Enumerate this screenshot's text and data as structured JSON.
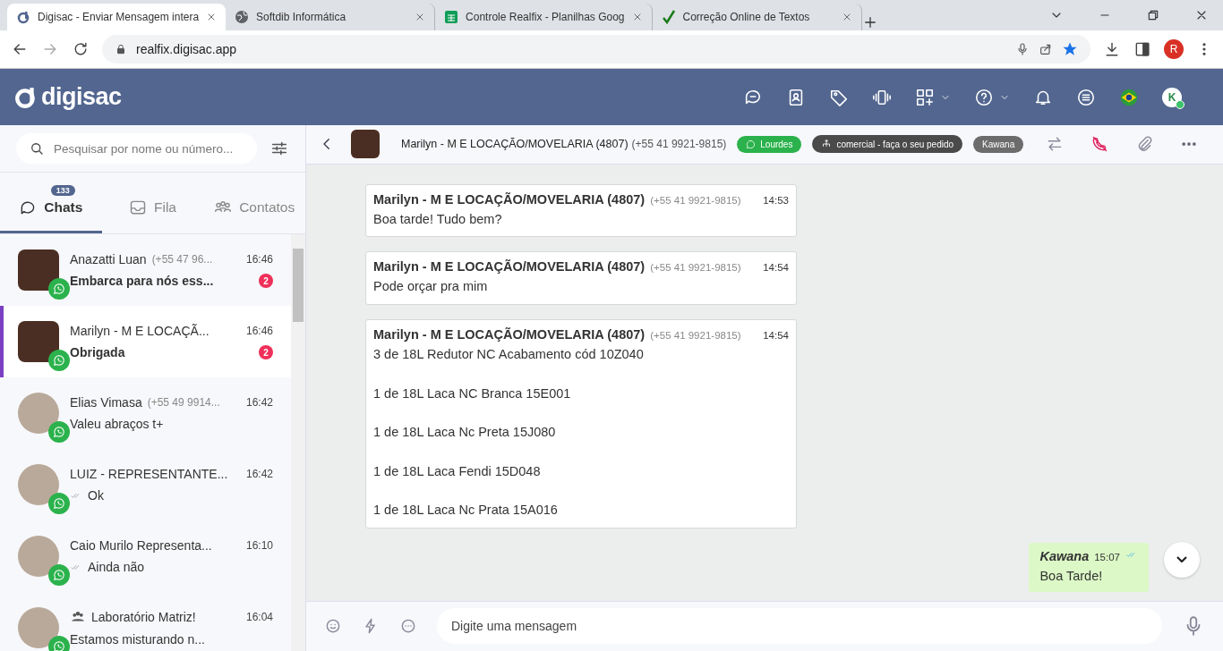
{
  "browser": {
    "tabs": [
      {
        "title": "Digisac - Enviar Mensagem intera",
        "kind": "digisac",
        "selected": true
      },
      {
        "title": "Softdib Informática",
        "kind": "globe",
        "selected": false
      },
      {
        "title": "Controle Realfix - Planilhas Goog",
        "kind": "sheets",
        "selected": false
      },
      {
        "title": "Correção Online de Textos",
        "kind": "check",
        "selected": false
      }
    ],
    "url": "realfix.digisac.app",
    "profile": "R"
  },
  "header": {
    "logo": "digisac",
    "user": "K"
  },
  "sidebar": {
    "search": {
      "placeholder": "Pesquisar por nome ou número..."
    },
    "tabs": [
      {
        "label": "Chats",
        "kind": "chat",
        "badge": "133",
        "selected": true
      },
      {
        "label": "Fila",
        "kind": "inbox",
        "selected": false
      },
      {
        "label": "Contatos",
        "kind": "people",
        "selected": false
      }
    ],
    "chats": [
      {
        "name": "Anazatti Luan",
        "phone": "(+55 47 96...",
        "time": "16:46",
        "preview": "Embarca para nós ess...",
        "unread": "2",
        "kind": "logo",
        "selected": false
      },
      {
        "name": "Marilyn - M E LOCAÇÃ...",
        "time": "16:46",
        "preview": "Obrigada",
        "unread": "2",
        "kind": "logo",
        "selected": true
      },
      {
        "name": "Elias Vimasa",
        "phone": "(+55 49 9914...",
        "time": "16:42",
        "preview": "Valeu abraços t+",
        "kind": "photo",
        "selected": false
      },
      {
        "name": "LUIZ - REPRESENTANTE...",
        "time": "16:42",
        "preview": "Ok",
        "ticks": true,
        "kind": "photo",
        "selected": false
      },
      {
        "name": "Caio Murilo Representa...",
        "time": "16:10",
        "preview": "Ainda não",
        "ticks": true,
        "kind": "photo",
        "selected": false
      },
      {
        "name": "Laboratório Matriz!",
        "group": true,
        "time": "16:04",
        "preview": "Estamos misturando n...",
        "kind": "photo",
        "selected": false
      }
    ]
  },
  "conversation": {
    "name": "Marilyn - M E LOCAÇÃO/MOVELARIA (4807)",
    "phone": "(+55 41 9921-9815)",
    "tags": [
      {
        "label": "Lourdes",
        "kind": "whatsapp",
        "color": "#2bb24c"
      },
      {
        "label": "comercial - faça o seu pedido",
        "kind": "department",
        "color": "#4a4a4a"
      },
      {
        "label": "Kawana",
        "kind": "user",
        "color": "#6c6c6c"
      }
    ],
    "messages": [
      {
        "kind": "in",
        "sender": "Marilyn - M E LOCAÇÃO/MOVELARIA (4807)",
        "phone": "(+55 41 9921-9815)",
        "time": "14:53",
        "text": "Boa tarde! Tudo bem?"
      },
      {
        "kind": "in",
        "sender": "Marilyn - M E LOCAÇÃO/MOVELARIA (4807)",
        "phone": "(+55 41 9921-9815)",
        "time": "14:54",
        "text": "Pode orçar pra mim"
      },
      {
        "kind": "in",
        "sender": "Marilyn - M E LOCAÇÃO/MOVELARIA (4807)",
        "phone": "(+55 41 9921-9815)",
        "time": "14:54",
        "text": "3 de 18L Redutor NC Acabamento cód 10Z040\n\n1 de 18L Laca NC Branca 15E001\n\n1 de 18L Laca Nc Preta 15J080\n\n1 de 18L Laca Fendi 15D048\n\n1 de 18L Laca Nc Prata 15A016"
      },
      {
        "kind": "out",
        "sender": "Kawana",
        "time": "15:07",
        "text": "Boa Tarde!",
        "read": true
      }
    ],
    "composer": {
      "placeholder": "Digite uma mensagem"
    }
  }
}
